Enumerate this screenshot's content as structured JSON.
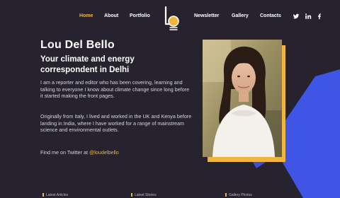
{
  "nav": {
    "home": "Home",
    "about": "About",
    "portfolio": "Portfolio",
    "newsletter": "Newsletter",
    "gallery": "Gallery",
    "contacts": "Contacts"
  },
  "social": [
    "twitter-icon",
    "linkedin-icon",
    "facebook-icon"
  ],
  "hero": {
    "name": "Lou Del Bello",
    "subtitle": "Your climate and energy correspondent in Delhi",
    "paragraph1": "I am a reporter and editor who has been covering, learning and talking to everyone I know about climate change since long before it started making the front pages.",
    "paragraph2": "Originally from Italy, I lived and worked in the UK and Kenya before landing in India, where I have worked for a range of mainstream science and environmental outlets.",
    "twitter_prefix": "Find me on Twitter at ",
    "twitter_handle": "@loudelbello"
  },
  "colors": {
    "background": "#26232f",
    "accent": "#f1b53d",
    "blue_shape": "#3e55e6"
  },
  "bottom_labels": [
    "Latest Articles",
    "Latest Stories",
    "Gallery Photos"
  ]
}
